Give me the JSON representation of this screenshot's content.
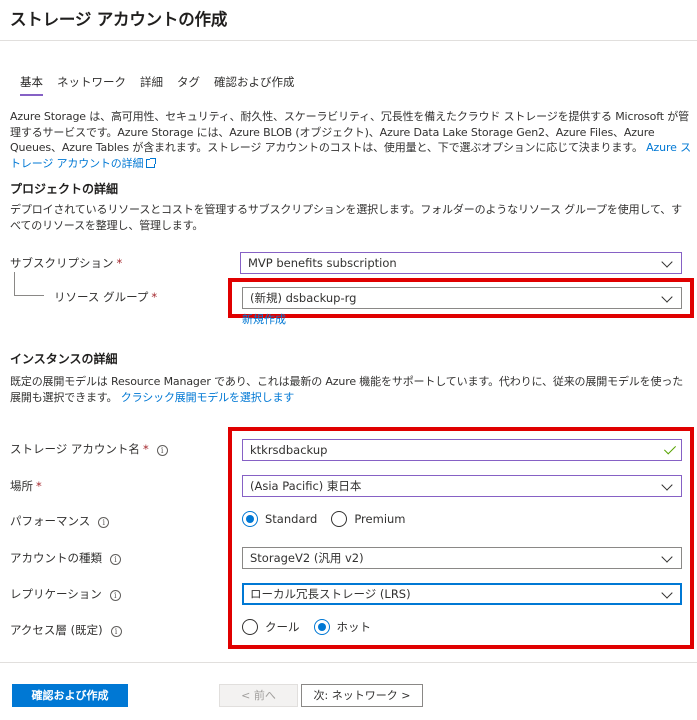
{
  "title": "ストレージ アカウントの作成",
  "tabs": [
    {
      "label": "基本"
    },
    {
      "label": "ネットワーク"
    },
    {
      "label": "詳細"
    },
    {
      "label": "タグ"
    },
    {
      "label": "確認および作成"
    }
  ],
  "intro": {
    "text": "Azure Storage は、高可用性、セキュリティ、耐久性、スケーラビリティ、冗長性を備えたクラウド ストレージを提供する Microsoft が管理するサービスです。Azure Storage には、Azure BLOB (オブジェクト)、Azure Data Lake Storage Gen2、Azure Files、Azure Queues、Azure Tables が含まれます。ストレージ アカウントのコストは、使用量と、下で選ぶオプションに応じて決まります。",
    "link": "Azure ストレージ アカウントの詳細"
  },
  "project": {
    "title": "プロジェクトの詳細",
    "description": "デプロイされているリソースとコストを管理するサブスクリプションを選択します。フォルダーのようなリソース グループを使用して、すべてのリソースを整理し、管理します。",
    "subscription_label": "サブスクリプション",
    "subscription_value": "MVP benefits subscription",
    "resource_group_label": "リソース グループ",
    "resource_group_value": "(新規) dsbackup-rg",
    "new_link": "新規作成"
  },
  "instance": {
    "title": "インスタンスの詳細",
    "description": "既定の展開モデルは Resource Manager であり、これは最新の Azure 機能をサポートしています。代わりに、従来の展開モデルを使った展開も選択できます。",
    "classic_link": "クラシック展開モデルを選択します",
    "account_name_label": "ストレージ アカウント名",
    "account_name_value": "ktkrsdbackup",
    "location_label": "場所",
    "location_value": "(Asia Pacific) 東日本",
    "performance_label": "パフォーマンス",
    "performance_options": [
      "Standard",
      "Premium"
    ],
    "performance_selected": "Standard",
    "account_kind_label": "アカウントの種類",
    "account_kind_value": "StorageV2 (汎用 v2)",
    "replication_label": "レプリケーション",
    "replication_value": "ローカル冗長ストレージ (LRS)",
    "access_tier_label": "アクセス層 (既定)",
    "access_tier_options": [
      "クール",
      "ホット"
    ],
    "access_tier_selected": "ホット"
  },
  "required_mark": "*",
  "info_glyph": "i",
  "footer": {
    "review_create": "確認および作成",
    "previous": "< 前へ",
    "next": "次: ネットワーク >"
  },
  "colors": {
    "accent": "#0078d4",
    "highlight": "#e00000",
    "tab_underline": "#8661c5",
    "valid": "#57a300"
  }
}
